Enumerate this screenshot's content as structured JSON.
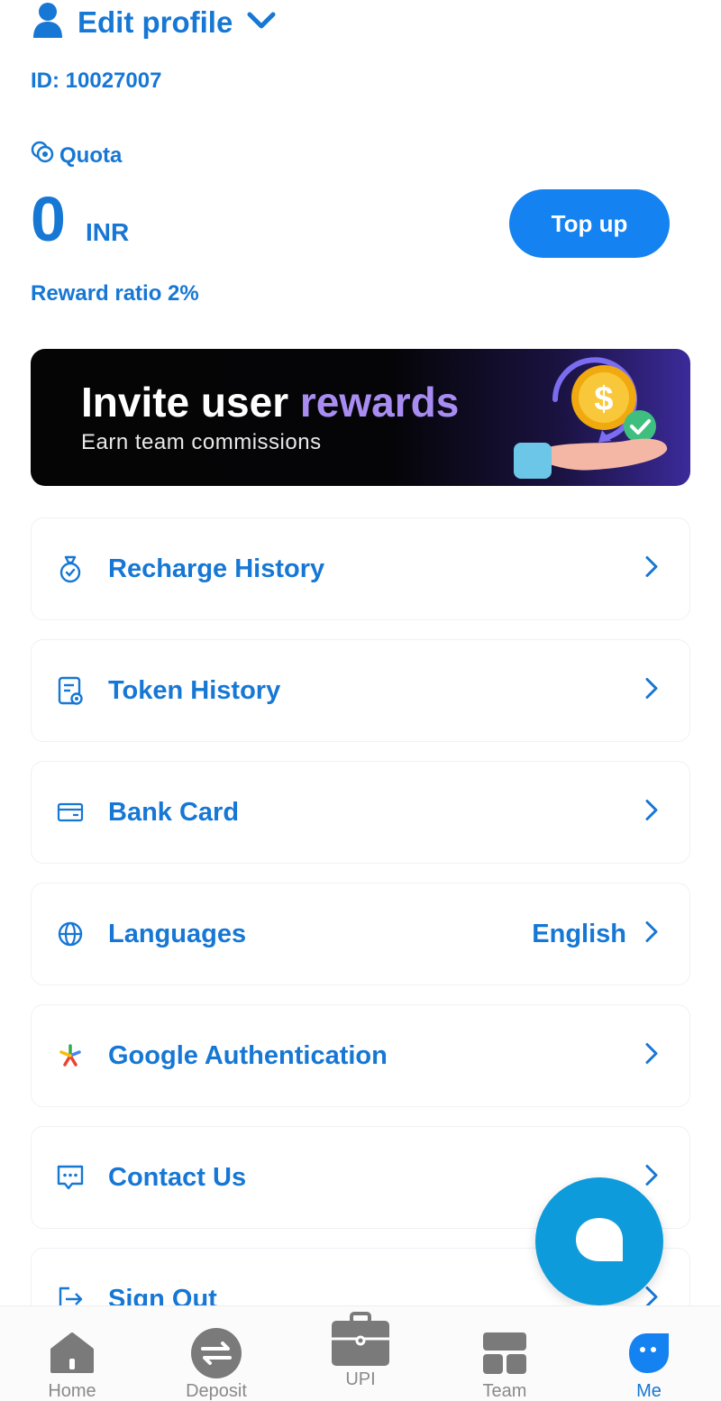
{
  "header": {
    "title": "Edit profile"
  },
  "account": {
    "id_text": "ID: 10027007"
  },
  "quota": {
    "label": "Quota",
    "amount": "0",
    "currency": "INR",
    "topup_label": "Top up",
    "reward_ratio": "Reward ratio 2%"
  },
  "banner": {
    "title_main": "Invite user ",
    "title_accent": "rewards",
    "subtitle": "Earn team commissions"
  },
  "menu": [
    {
      "label": "Recharge History",
      "icon": "money-bag-icon",
      "value": ""
    },
    {
      "label": "Token History",
      "icon": "document-icon",
      "value": ""
    },
    {
      "label": "Bank Card",
      "icon": "card-icon",
      "value": ""
    },
    {
      "label": "Languages",
      "icon": "globe-icon",
      "value": "English"
    },
    {
      "label": "Google Authentication",
      "icon": "google-auth-icon",
      "value": ""
    },
    {
      "label": "Contact Us",
      "icon": "chat-icon",
      "value": ""
    },
    {
      "label": "Sign Out",
      "icon": "logout-icon",
      "value": ""
    }
  ],
  "nav": [
    {
      "label": "Home",
      "icon": "home-icon",
      "active": false
    },
    {
      "label": "Deposit",
      "icon": "transfer-icon",
      "active": false
    },
    {
      "label": "UPI",
      "icon": "briefcase-icon",
      "active": false
    },
    {
      "label": "Team",
      "icon": "team-grid-icon",
      "active": false
    },
    {
      "label": "Me",
      "icon": "me-face-icon",
      "active": true
    }
  ],
  "colors": {
    "primary": "#1677d4",
    "button": "#1482f0",
    "fab": "#0e9bdc",
    "accent_purple": "#a98cf2",
    "nav_inactive": "#8a8a8a"
  }
}
